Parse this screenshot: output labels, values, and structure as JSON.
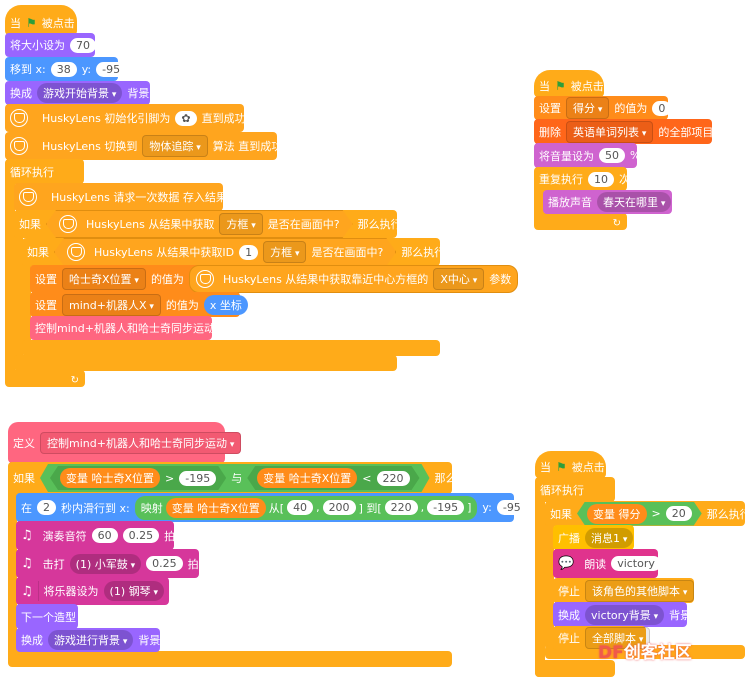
{
  "colors": {
    "control": "#FFAB19",
    "motion": "#4C97FF",
    "looks": "#9966FF",
    "variables": "#FF8C1A",
    "lists": "#FF661A",
    "sound": "#CF63CF",
    "events": "#FFBF00",
    "my_blocks": "#FF6680",
    "music": "#D6379B",
    "text2speech": "#E0338D",
    "operators": "#59C059"
  },
  "script1": {
    "hat": {
      "when": "当",
      "clicked": "被点击"
    },
    "set_size": {
      "label": "将大小设为",
      "value": "70"
    },
    "goto": {
      "label": "移到 x:",
      "x": "38",
      "ylabel": "y:",
      "y": "-95"
    },
    "switch_backdrop": {
      "label": "换成",
      "value": "游戏开始背景",
      "suffix": "背景"
    },
    "husky_init": {
      "label": "HuskyLens 初始化引脚为",
      "suffix": "直到成功"
    },
    "husky_switch": {
      "label": "HuskyLens 切换到",
      "value": "物体追踪",
      "suffix": "算法 直到成功"
    },
    "forever": {
      "label": "循环执行"
    },
    "husky_request": {
      "label": "HuskyLens 请求一次数据 存入结果"
    },
    "if1": {
      "if": "如果",
      "cond": "HuskyLens 从结果中获取",
      "value": "方框",
      "cond2": "是否在画面中?",
      "then": "那么执行"
    },
    "if2": {
      "if": "如果",
      "cond": "HuskyLens 从结果中获取ID",
      "id": "1",
      "value": "方框",
      "cond2": "是否在画面中?",
      "then": "那么执行"
    },
    "set_var1": {
      "label": "设置",
      "var": "哈士奇X位置",
      "mid": "的值为",
      "rep": "HuskyLens 从结果中获取靠近中心方框的",
      "param": "X中心",
      "suffix": "参数"
    },
    "set_var2": {
      "label": "设置",
      "var": "mind+机器人X",
      "mid": "的值为",
      "rep": "x 坐标"
    },
    "call": {
      "label": "控制mind+机器人和哈士奇同步运动"
    }
  },
  "script2": {
    "define": {
      "label": "定义",
      "name": "控制mind+机器人和哈士奇同步运动"
    },
    "if": {
      "if": "如果",
      "var_label": "变量 哈士奇X位置",
      "gt": ">",
      "v1": "-195",
      "and": "与",
      "var_label2": "变量 哈士奇X位置",
      "lt": "<",
      "v2": "220",
      "then": "那么执行"
    },
    "glide": {
      "in": "在",
      "secs": "2",
      "label": "秒内滑行到 x:",
      "map": "映射",
      "var_label": "变量 哈士奇X位置",
      "from": "从[",
      "a": "40",
      "comma": ",",
      "b": "200",
      "to": "] 到[",
      "c": "220",
      "d": "-195",
      "close": "]",
      "ylabel": "y:",
      "y": "-95"
    },
    "play_note": {
      "label": "演奏音符",
      "note": "60",
      "beats": "0.25",
      "suffix": "拍"
    },
    "drum": {
      "label": "击打",
      "drum": "(1) 小军鼓",
      "beats": "0.25",
      "suffix": "拍"
    },
    "instrument": {
      "label": "将乐器设为",
      "value": "(1) 钢琴"
    },
    "next_costume": {
      "label": "下一个造型"
    },
    "switch_backdrop": {
      "label": "换成",
      "value": "游戏进行背景",
      "suffix": "背景"
    }
  },
  "script3": {
    "hat": {
      "when": "当",
      "clicked": "被点击"
    },
    "set_var": {
      "label": "设置",
      "var": "得分",
      "mid": "的值为",
      "value": "0"
    },
    "delete_all": {
      "label": "删除",
      "list": "英语单词列表",
      "suffix": "的全部项目"
    },
    "volume": {
      "label": "将音量设为",
      "value": "50",
      "suffix": "%"
    },
    "repeat": {
      "label": "重复执行",
      "value": "10",
      "suffix": "次"
    },
    "play_sound": {
      "label": "播放声音",
      "value": "春天在哪里"
    }
  },
  "script4": {
    "hat": {
      "when": "当",
      "clicked": "被点击"
    },
    "forever": {
      "label": "循环执行"
    },
    "if": {
      "if": "如果",
      "var_label": "变量 得分",
      "gt": ">",
      "value": "20",
      "then": "那么执行"
    },
    "broadcast": {
      "label": "广播",
      "value": "消息1"
    },
    "speak": {
      "label": "朗读",
      "value": "victory"
    },
    "stop1": {
      "label": "停止",
      "value": "该角色的其他脚本"
    },
    "switch_backdrop": {
      "label": "换成",
      "value": "victory背景",
      "suffix": "背景"
    },
    "stop2": {
      "label": "停止",
      "value": "全部脚本"
    }
  },
  "watermark": {
    "brand": "DF",
    "text": "创客社区"
  }
}
